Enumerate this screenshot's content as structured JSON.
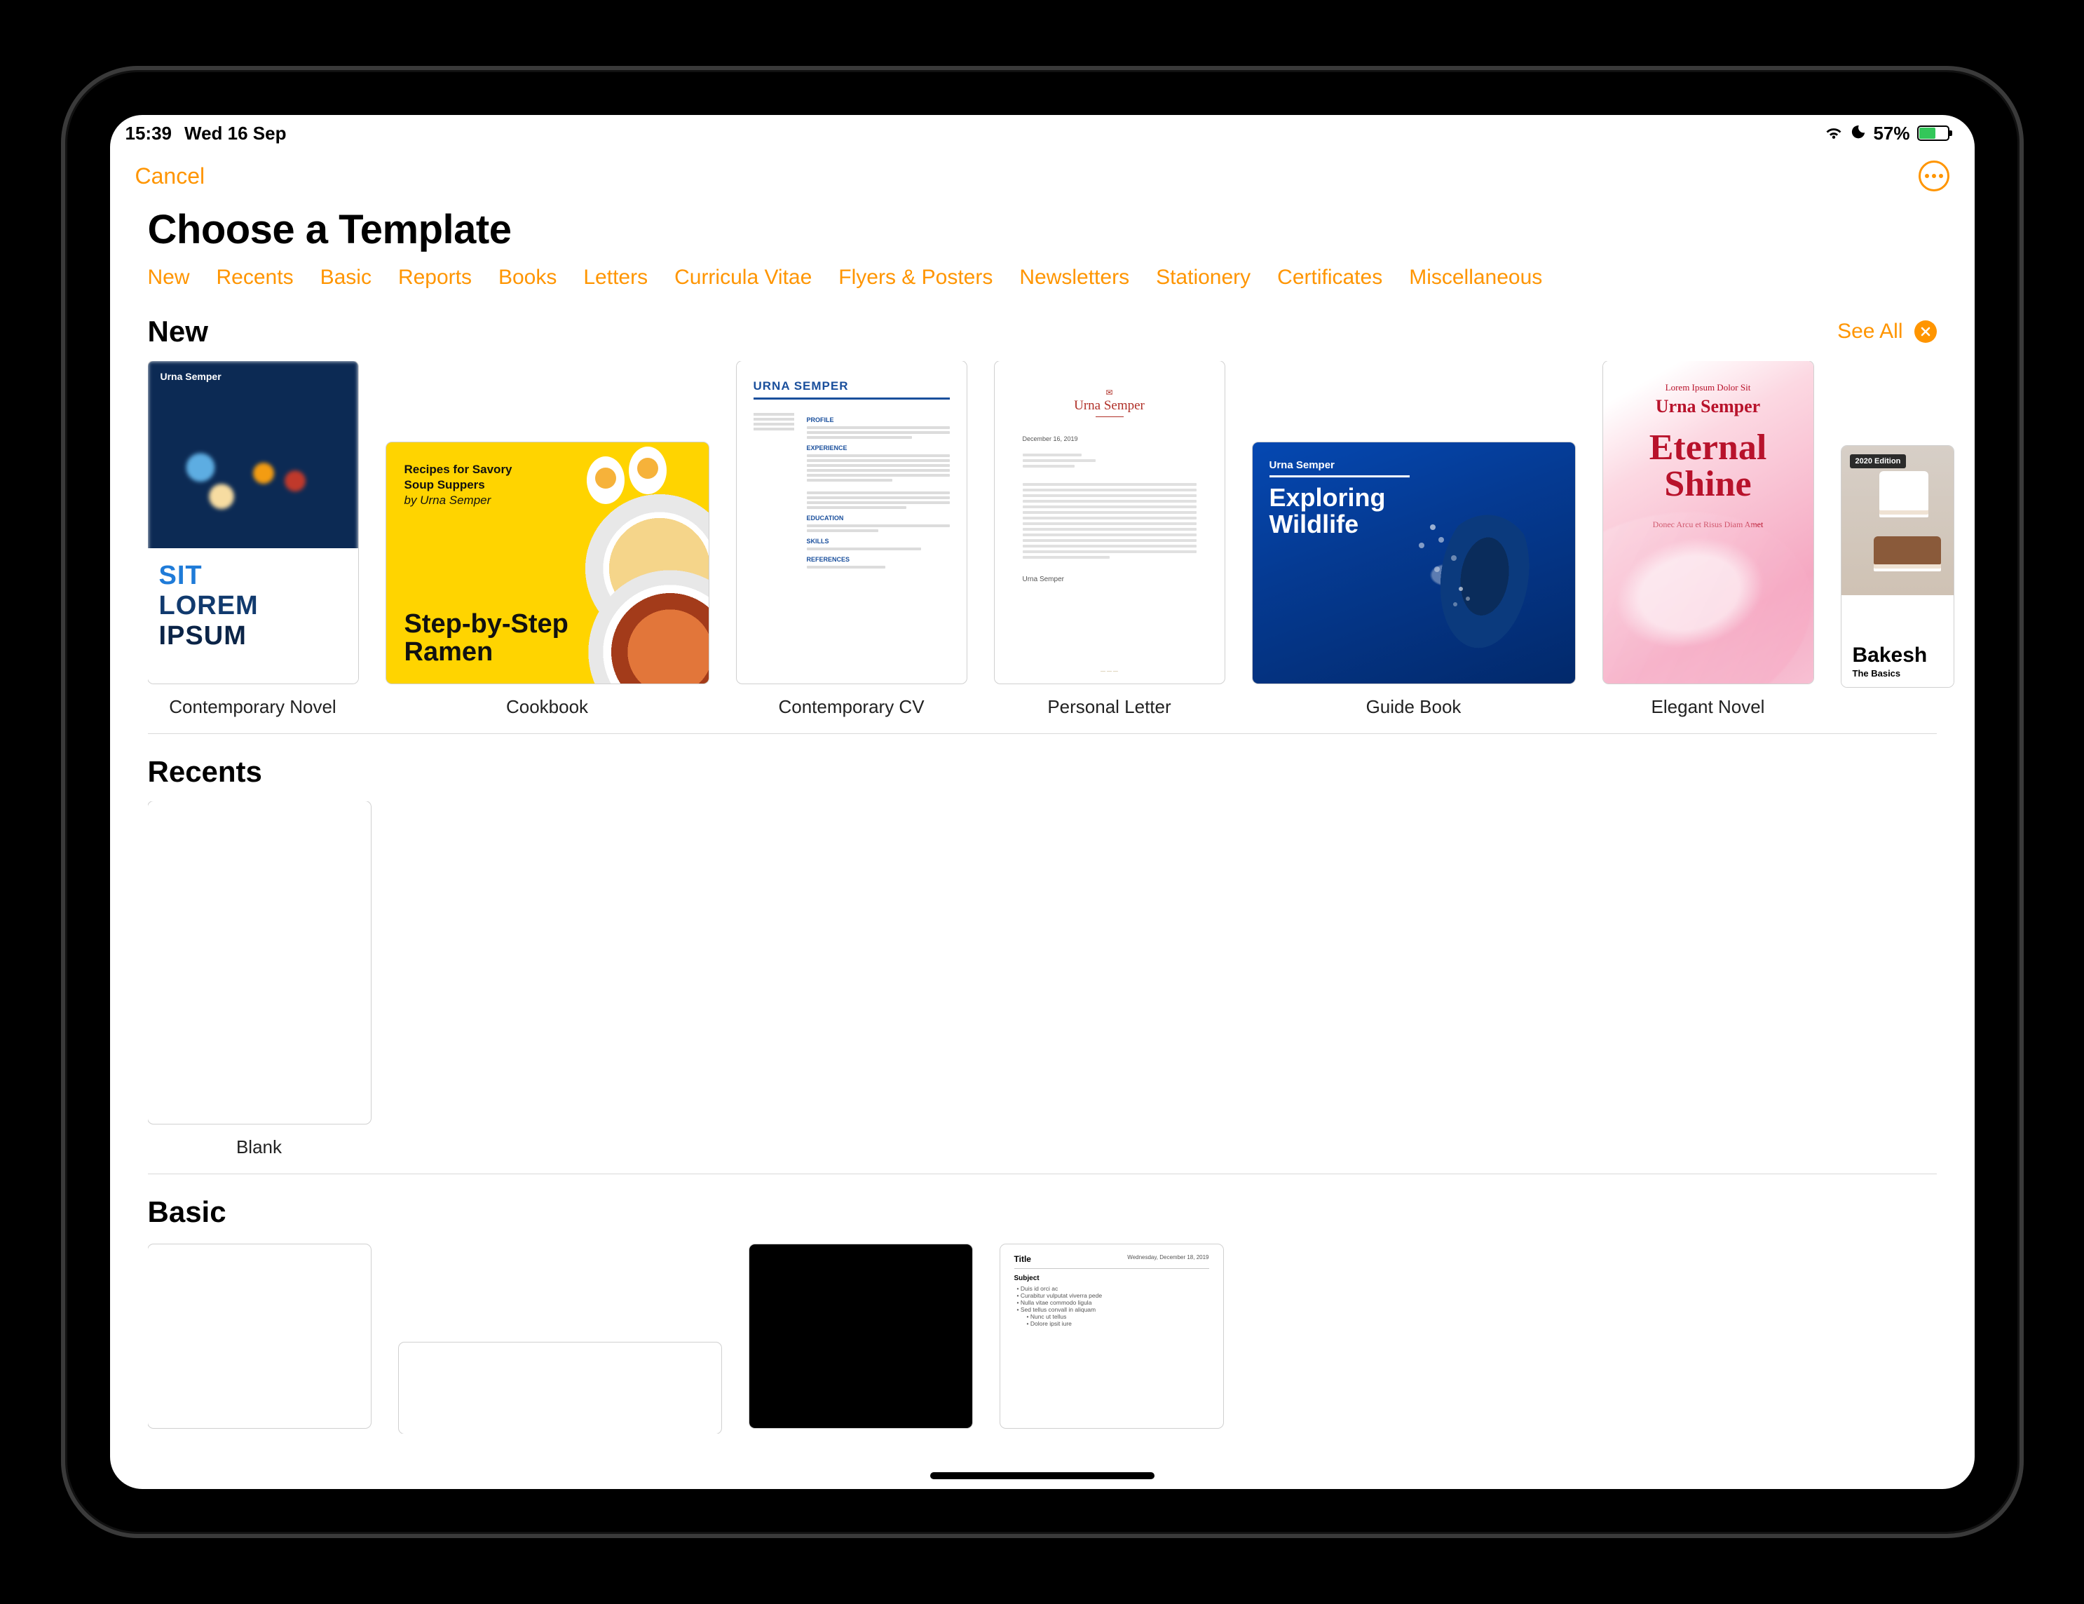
{
  "status": {
    "time": "15:39",
    "date": "Wed 16 Sep",
    "battery_text": "57%",
    "battery_fill_pct": 57
  },
  "nav": {
    "cancel": "Cancel"
  },
  "title": "Choose a Template",
  "tabs": [
    "New",
    "Recents",
    "Basic",
    "Reports",
    "Books",
    "Letters",
    "Curricula Vitae",
    "Flyers & Posters",
    "Newsletters",
    "Stationery",
    "Certificates",
    "Miscellaneous"
  ],
  "sections": {
    "new": {
      "title": "New",
      "see_all": "See All",
      "items": [
        {
          "label": "Contemporary Novel",
          "thumb": {
            "author": "Urna Semper",
            "l1": "SIT",
            "l2": "LOREM",
            "l3": "IPSUM"
          }
        },
        {
          "label": "Cookbook",
          "thumb": {
            "sub1": "Recipes for Savory",
            "sub2": "Soup Suppers",
            "sub3": "by Urna Semper",
            "title1": "Step-by-Step",
            "title2": "Ramen"
          }
        },
        {
          "label": "Contemporary CV",
          "thumb": {
            "name": "URNA SEMPER",
            "h1": "PROFILE",
            "h2": "EXPERIENCE",
            "h3": "EDUCATION",
            "h4": "SKILLS",
            "h5": "REFERENCES"
          }
        },
        {
          "label": "Personal Letter",
          "thumb": {
            "name": "Urna Semper",
            "date": "December 16, 2019",
            "sig": "Urna Semper"
          }
        },
        {
          "label": "Guide Book",
          "thumb": {
            "author": "Urna Semper",
            "t1": "Exploring",
            "t2": "Wildlife"
          }
        },
        {
          "label": "Elegant Novel",
          "thumb": {
            "t1": "Lorem Ipsum Dolor Sit",
            "t2": "Urna Semper",
            "t3a": "Eternal",
            "t3b": "Shine",
            "t4": "Donec Arcu et Risus Diam Amet"
          }
        },
        {
          "label": "",
          "thumb": {
            "badge": "2020 Edition",
            "t1": "Bakesh",
            "t2": "The Basics"
          }
        }
      ]
    },
    "recents": {
      "title": "Recents",
      "items": [
        {
          "label": "Blank"
        }
      ]
    },
    "basic": {
      "title": "Basic",
      "items": [
        {
          "label": ""
        },
        {
          "label": ""
        },
        {
          "label": ""
        },
        {
          "label": "",
          "note": {
            "title": "Title",
            "date": "Wednesday, December 18, 2019",
            "subject": "Subject",
            "bullets": [
              "Duis id orci ac",
              "Curabitur vulputat viverra pede",
              "Nulla vitae commodo ligula",
              "Sed tellus convall in aliquam"
            ],
            "subbullets": [
              "Nunc ut tellus",
              "Dolore ipsit iure"
            ]
          }
        }
      ]
    }
  }
}
